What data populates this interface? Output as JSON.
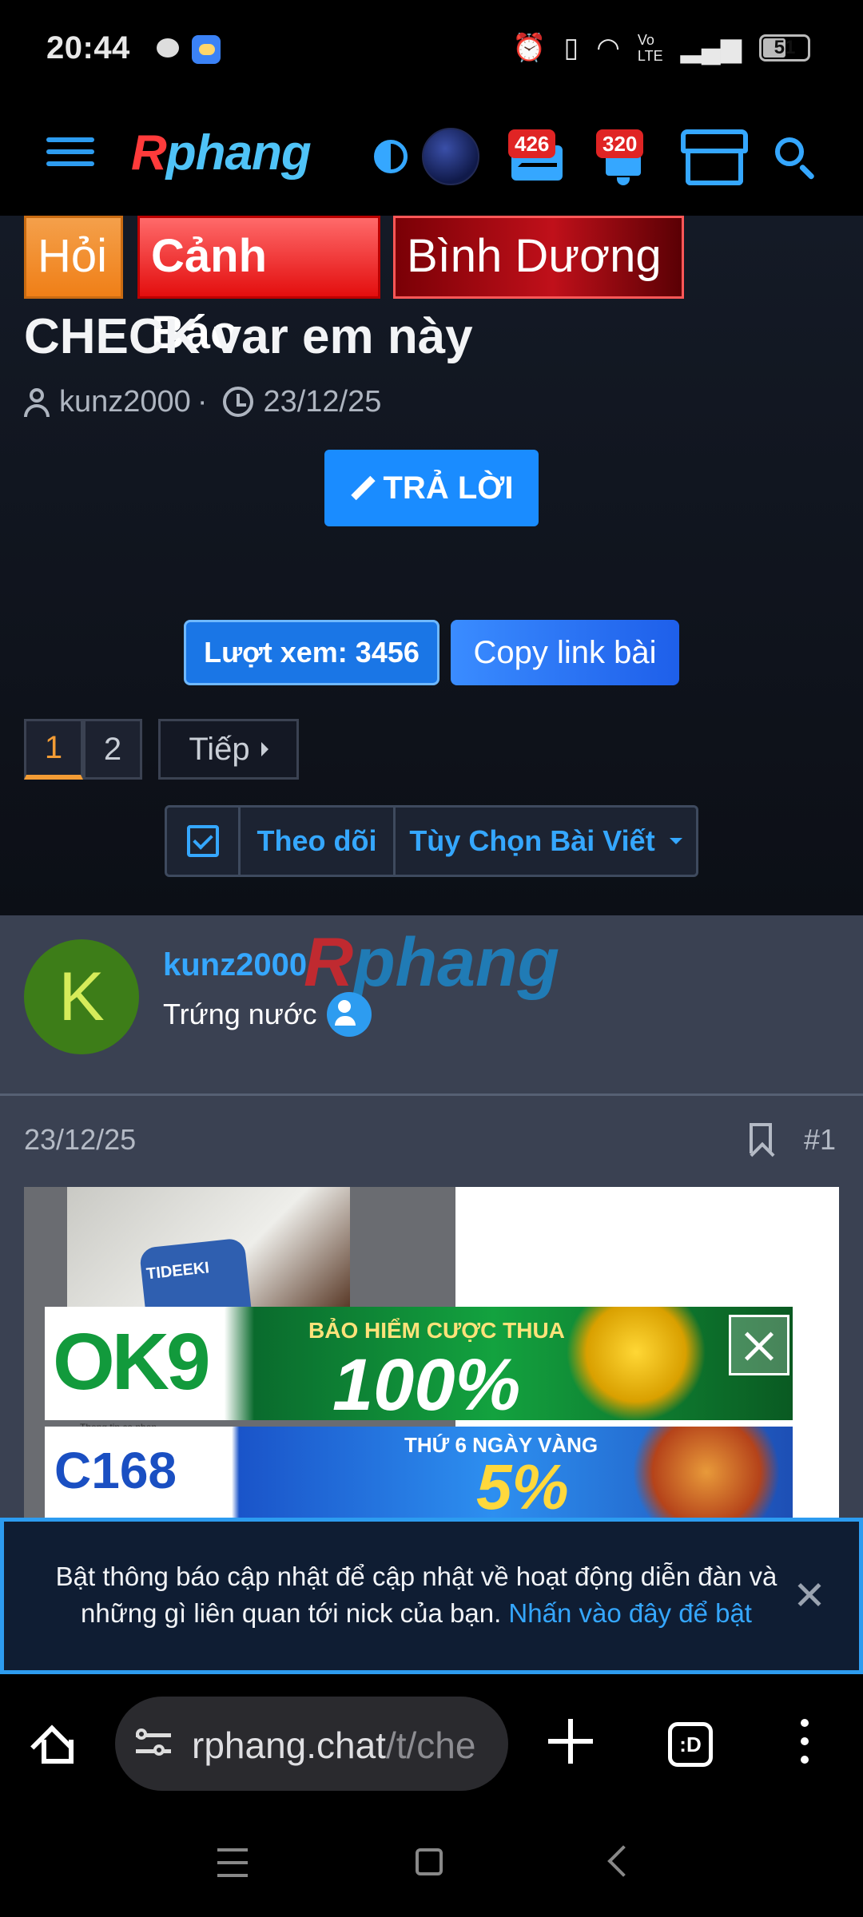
{
  "status_bar": {
    "time": "20:44",
    "battery": "51",
    "icons": [
      "message-icon",
      "weather-icon",
      "alarm-icon",
      "vibrate-icon",
      "wifi-icon",
      "volte-icon",
      "signal-icon",
      "battery-icon"
    ]
  },
  "header": {
    "logo_r": "R",
    "logo_rest": "phang",
    "mail_badge": "426",
    "notif_badge": "320",
    "accent_color": "#35a7ff"
  },
  "thread": {
    "prefixes": [
      "Hỏi",
      "Cảnh Báo",
      "Bình Dương"
    ],
    "title": "CHECK var em này",
    "author": "kunz2000",
    "separator": "·",
    "date": "23/12/25",
    "reply_label": "TRẢ LỜI",
    "views_label": "Lượt xem: 3456",
    "copy_label": "Copy link bài",
    "pages": [
      "1",
      "2"
    ],
    "current_page": "1",
    "next_label": "Tiếp",
    "follow_label": "Theo dõi",
    "options_label": "Tùy Chọn Bài Viết"
  },
  "post": {
    "avatar_letter": "K",
    "username": "kunz2000",
    "watermark_r": "R",
    "watermark_rest": "phang",
    "user_title": "Trứng nước",
    "date": "23/12/25",
    "post_number": "#1",
    "image_caption": "Thong tin ca nhan"
  },
  "ads": {
    "ok9_logo": "OK9",
    "ok9_headline": "BẢO HIỂM CƯỢC THUA",
    "ok9_percent": "100%",
    "c168_logo": "C168",
    "c168_headline": "THỨ 6 NGÀY VÀNG",
    "c168_percent": "5%"
  },
  "notice": {
    "text": "Bật thông báo cập nhật để cập nhật về hoạt động diễn đàn và những gì liên quan tới nick của bạn. ",
    "link": "Nhấn vào đây để bật"
  },
  "browser": {
    "url_host": "rphang.chat",
    "url_path": "/t/che",
    "tabs_label": ":D"
  }
}
